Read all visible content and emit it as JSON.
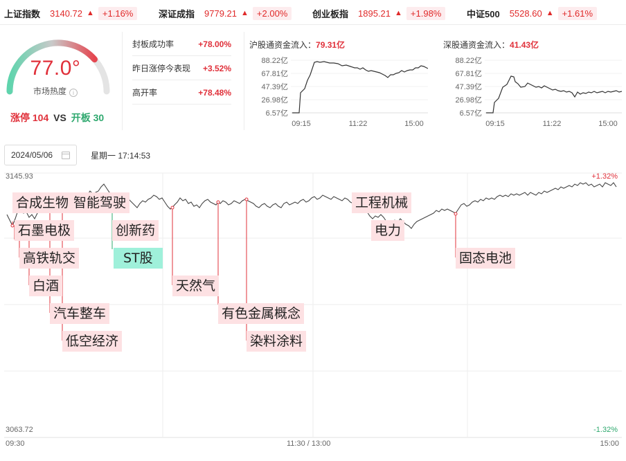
{
  "indices": [
    {
      "name": "上证指数",
      "value": "3140.72",
      "arrow": "▲",
      "change": "+1.16%"
    },
    {
      "name": "深证成指",
      "value": "9779.21",
      "arrow": "▲",
      "change": "+2.00%"
    },
    {
      "name": "创业板指",
      "value": "1895.21",
      "arrow": "▲",
      "change": "+1.98%"
    },
    {
      "name": "中证500",
      "value": "5528.60",
      "arrow": "▲",
      "change": "+1.61%"
    }
  ],
  "sentiment": {
    "value": "77.0°",
    "value_fraction": 0.77,
    "label": "市场热度",
    "info_icon": "i",
    "limit_up_label": "涨停",
    "limit_up": "104",
    "vs": "VS",
    "open_label": "开板",
    "open": "30"
  },
  "stats": [
    {
      "label": "封板成功率",
      "value": "+78.00%"
    },
    {
      "label": "昨日涨停今表现",
      "value": "+3.52%"
    },
    {
      "label": "高开率",
      "value": "+78.48%"
    }
  ],
  "inflow": [
    {
      "title": "沪股通资金流入：",
      "amount": "79.31亿",
      "y_ticks": [
        "88.22亿",
        "67.81亿",
        "47.39亿",
        "26.98亿",
        "6.57亿"
      ],
      "x_ticks": [
        "09:15",
        "11:22",
        "15:00"
      ]
    },
    {
      "title": "深股通资金流入：",
      "amount": "41.43亿",
      "y_ticks": [
        "88.22亿",
        "67.81亿",
        "47.39亿",
        "26.98亿",
        "6.57亿"
      ],
      "x_ticks": [
        "09:15",
        "11:22",
        "15:00"
      ]
    }
  ],
  "date": "2024/05/06",
  "time": "星期一 17:14:53",
  "main": {
    "y_top": "3145.93",
    "y_bottom": "3063.72",
    "pct_top": "+1.32%",
    "pct_bottom": "-1.32%",
    "x_ticks": [
      "09:30",
      "11:30 / 13:00",
      "15:00"
    ],
    "tags": {
      "t1": "合成生物",
      "t2": "智能驾驶",
      "t3": "石墨电极",
      "t4": "创新药",
      "t5": "高铁轨交",
      "t6": "ST股",
      "t7": "白酒",
      "t8": "天然气",
      "t9": "汽车整车",
      "t10": "有色金属概念",
      "t11": "低空经济",
      "t12": "染料涂料",
      "t13": "工程机械",
      "t14": "电力",
      "t15": "固态电池"
    }
  },
  "colors": {
    "up": "#e0303a",
    "down": "#2ea86e",
    "tag_bg": "#fde1e3",
    "tag_green": "#9ff0da"
  }
}
